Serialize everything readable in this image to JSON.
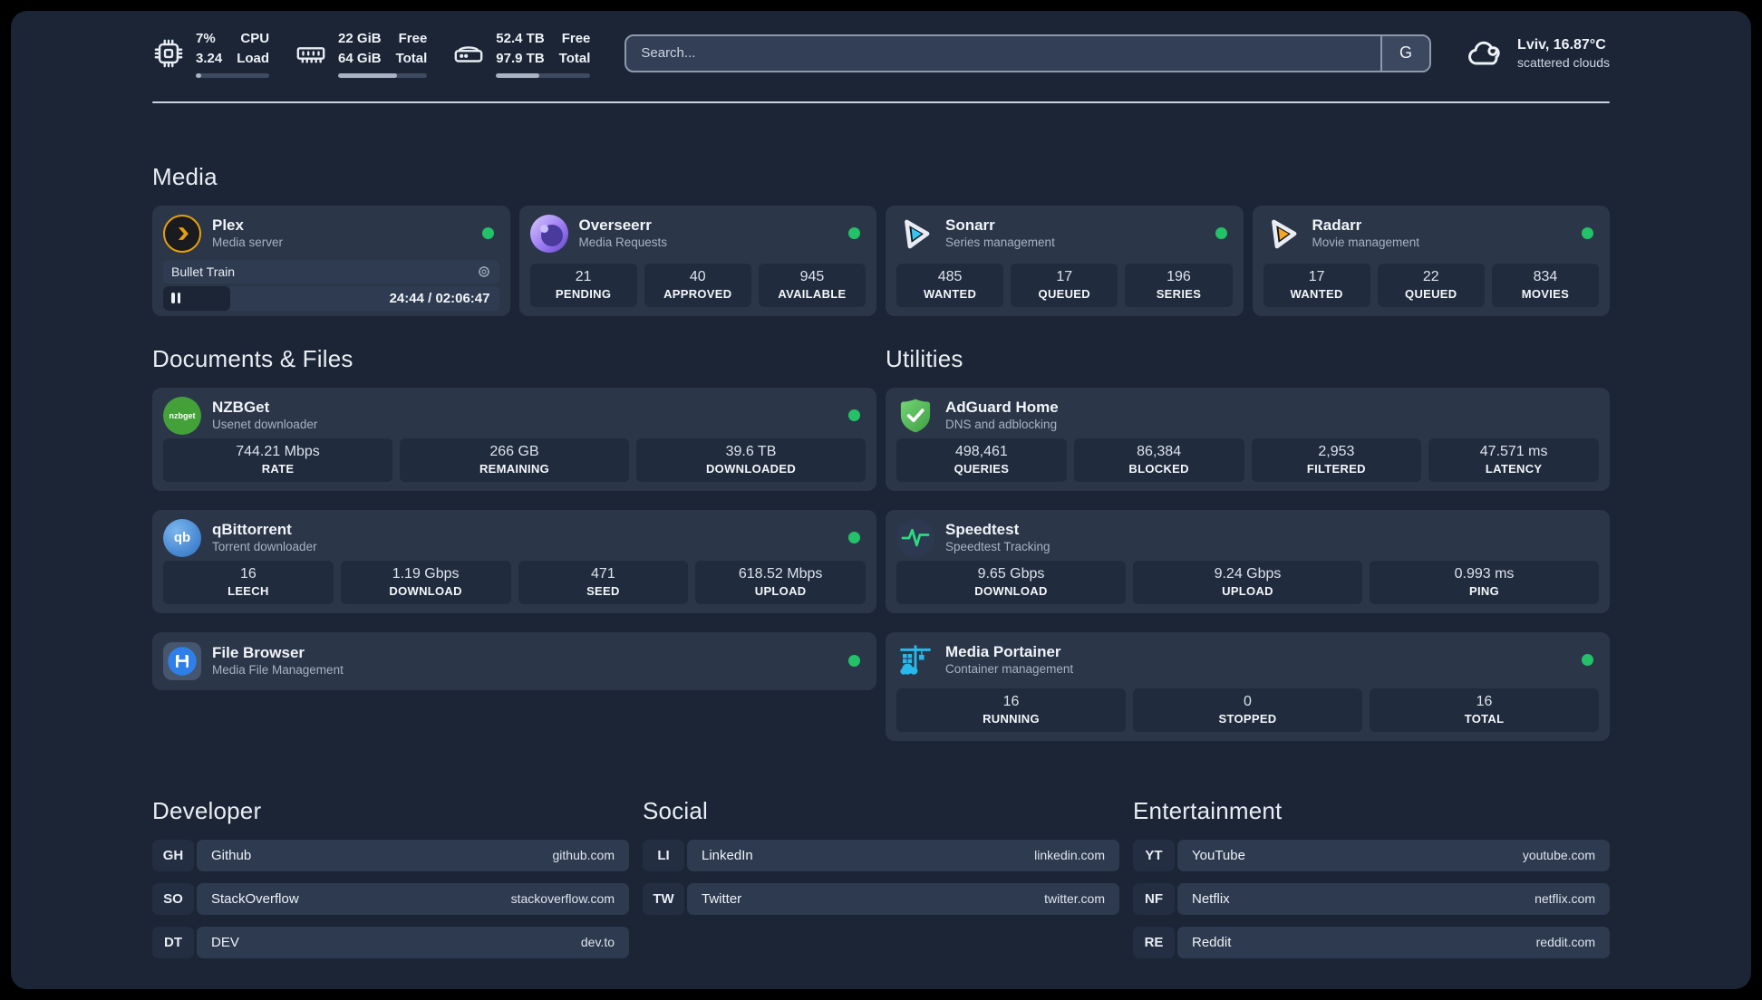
{
  "colors": {
    "status_online": "#23c268",
    "plex_accent": "#e5a00d",
    "sonarr_accent": "#35c5f4",
    "radarr_accent": "#f5a623",
    "portainer_accent": "#29b8eb",
    "speedtest_accent": "#2fd980"
  },
  "header": {
    "system_stats": [
      {
        "name": "cpu",
        "value_top": "7%",
        "value_bottom": "3.24",
        "label_top": "CPU",
        "label_bottom": "Load",
        "progress_pct": 7
      },
      {
        "name": "memory",
        "value_top": "22 GiB",
        "value_bottom": "64 GiB",
        "label_top": "Free",
        "label_bottom": "Total",
        "progress_pct": 66
      },
      {
        "name": "storage",
        "value_top": "52.4 TB",
        "value_bottom": "97.9 TB",
        "label_top": "Free",
        "label_bottom": "Total",
        "progress_pct": 46
      }
    ],
    "search": {
      "placeholder": "Search...",
      "engine_button": "G"
    },
    "weather": {
      "location_temp": "Lviv, 16.87°C",
      "condition": "scattered clouds"
    }
  },
  "sections": {
    "media": "Media",
    "documents": "Documents & Files",
    "utilities": "Utilities",
    "developer": "Developer",
    "social": "Social",
    "entertainment": "Entertainment"
  },
  "apps": {
    "plex": {
      "title": "Plex",
      "subtitle": "Media server",
      "now_playing": {
        "track": "Bullet Train",
        "time": "24:44 / 02:06:47",
        "progress_pct": 20
      }
    },
    "overseerr": {
      "title": "Overseerr",
      "subtitle": "Media Requests",
      "stats": [
        {
          "value": "21",
          "label": "PENDING"
        },
        {
          "value": "40",
          "label": "APPROVED"
        },
        {
          "value": "945",
          "label": "AVAILABLE"
        }
      ]
    },
    "sonarr": {
      "title": "Sonarr",
      "subtitle": "Series management",
      "stats": [
        {
          "value": "485",
          "label": "WANTED"
        },
        {
          "value": "17",
          "label": "QUEUED"
        },
        {
          "value": "196",
          "label": "SERIES"
        }
      ]
    },
    "radarr": {
      "title": "Radarr",
      "subtitle": "Movie management",
      "stats": [
        {
          "value": "17",
          "label": "WANTED"
        },
        {
          "value": "22",
          "label": "QUEUED"
        },
        {
          "value": "834",
          "label": "MOVIES"
        }
      ]
    },
    "nzbget": {
      "title": "NZBGet",
      "subtitle": "Usenet downloader",
      "icon_text": "nzbget",
      "stats": [
        {
          "value": "744.21 Mbps",
          "label": "RATE"
        },
        {
          "value": "266 GB",
          "label": "REMAINING"
        },
        {
          "value": "39.6 TB",
          "label": "DOWNLOADED"
        }
      ]
    },
    "qbittorrent": {
      "title": "qBittorrent",
      "subtitle": "Torrent downloader",
      "icon_text": "qb",
      "stats": [
        {
          "value": "16",
          "label": "LEECH"
        },
        {
          "value": "1.19 Gbps",
          "label": "DOWNLOAD"
        },
        {
          "value": "471",
          "label": "SEED"
        },
        {
          "value": "618.52 Mbps",
          "label": "UPLOAD"
        }
      ]
    },
    "filebrowser": {
      "title": "File Browser",
      "subtitle": "Media File Management"
    },
    "adguard": {
      "title": "AdGuard Home",
      "subtitle": "DNS and adblocking",
      "stats": [
        {
          "value": "498,461",
          "label": "QUERIES"
        },
        {
          "value": "86,384",
          "label": "BLOCKED"
        },
        {
          "value": "2,953",
          "label": "FILTERED"
        },
        {
          "value": "47.571 ms",
          "label": "LATENCY"
        }
      ]
    },
    "speedtest": {
      "title": "Speedtest",
      "subtitle": "Speedtest Tracking",
      "stats": [
        {
          "value": "9.65 Gbps",
          "label": "DOWNLOAD"
        },
        {
          "value": "9.24 Gbps",
          "label": "UPLOAD"
        },
        {
          "value": "0.993 ms",
          "label": "PING"
        }
      ]
    },
    "portainer": {
      "title": "Media Portainer",
      "subtitle": "Container management",
      "stats": [
        {
          "value": "16",
          "label": "RUNNING"
        },
        {
          "value": "0",
          "label": "STOPPED"
        },
        {
          "value": "16",
          "label": "TOTAL"
        }
      ]
    }
  },
  "links": {
    "developer": [
      {
        "abbr": "GH",
        "name": "Github",
        "url": "github.com"
      },
      {
        "abbr": "SO",
        "name": "StackOverflow",
        "url": "stackoverflow.com"
      },
      {
        "abbr": "DT",
        "name": "DEV",
        "url": "dev.to"
      }
    ],
    "social": [
      {
        "abbr": "LI",
        "name": "LinkedIn",
        "url": "linkedin.com"
      },
      {
        "abbr": "TW",
        "name": "Twitter",
        "url": "twitter.com"
      }
    ],
    "entertainment": [
      {
        "abbr": "YT",
        "name": "YouTube",
        "url": "youtube.com"
      },
      {
        "abbr": "NF",
        "name": "Netflix",
        "url": "netflix.com"
      },
      {
        "abbr": "RE",
        "name": "Reddit",
        "url": "reddit.com"
      }
    ]
  }
}
